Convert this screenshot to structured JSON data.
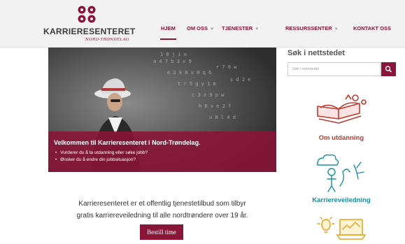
{
  "header": {
    "logo_text": "KARRIERESENTERET",
    "logo_subtext": "NORD-TRØNDELAG",
    "nav": [
      {
        "label": "HJEM",
        "active": true
      },
      {
        "label": "OM OSS",
        "dropdown": true
      },
      {
        "label": "TJENESTER",
        "dropdown": true
      },
      {
        "label": "RESSURSSENTER",
        "dropdown": true
      },
      {
        "label": "KONTAKT OSS"
      }
    ]
  },
  "hero": {
    "title": "Velkommen til Karrieresenteret i Nord-Trøndelag.",
    "bullets": [
      "Vurderer du å ta utdanning eller søke jobb?",
      "Ønsker du å endre din jobbsituasjon?"
    ]
  },
  "intro": {
    "line1": "Karrieresenteret er et offentlig tjenestetilbud som tilbyr",
    "line2": "gratis karriereveiledning til alle nordtrøndere over 19 år."
  },
  "cta": {
    "label": "Bestill time"
  },
  "sidebar": {
    "search_title": "Søk i nettstedet",
    "search_placeholder": "Søk i nettstedet",
    "links": [
      {
        "label": "Om utdanning",
        "icon": "book-icon",
        "color": "#c0392b"
      },
      {
        "label": "Karriereveiledning",
        "icon": "person-thinking-icon",
        "color": "#1a8fa3"
      }
    ],
    "partial_icon": "lightbulb-laptop-icon"
  },
  "colors": {
    "brand": "#8a1538",
    "accent_red": "#c0392b",
    "accent_teal": "#1a8fa3",
    "accent_orange": "#e9a21a"
  }
}
